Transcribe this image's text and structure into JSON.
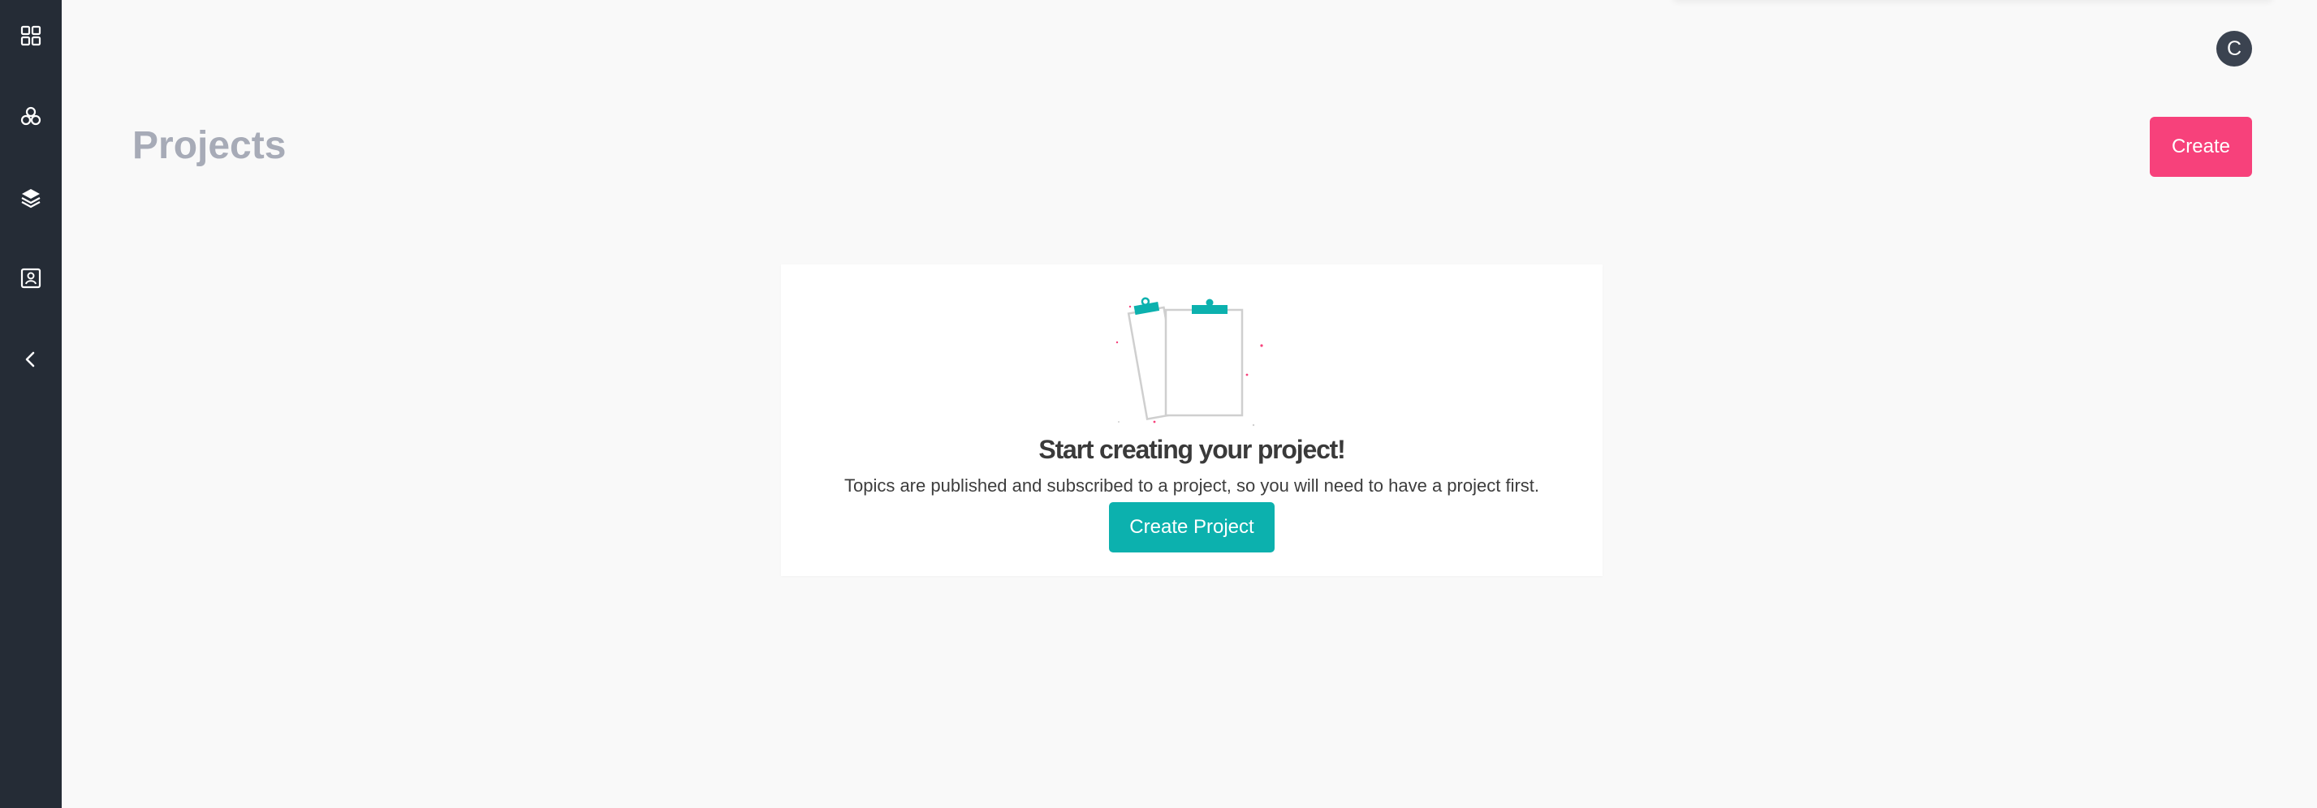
{
  "sidebar": {
    "items": [
      {
        "icon": "grid-icon",
        "label": ""
      },
      {
        "icon": "cluster-icon",
        "label": ""
      },
      {
        "icon": "layers-icon",
        "label": ""
      },
      {
        "icon": "contact-card-icon",
        "label": ""
      },
      {
        "icon": "chevron-left-icon",
        "label": ""
      }
    ],
    "background": "#252c36"
  },
  "header": {
    "avatar_initial": "C"
  },
  "page": {
    "title": "Projects",
    "create_label": "Create"
  },
  "empty_state": {
    "title": "Start creating your project!",
    "description": "Topics are published and subscribed to a project, so you will need to have a project first.",
    "button_label": "Create Project",
    "illustration": "clipboard-illustration"
  },
  "colors": {
    "accent_pink": "#f7417b",
    "accent_teal": "#0cb1ae",
    "title_gray": "#a7abb7"
  }
}
